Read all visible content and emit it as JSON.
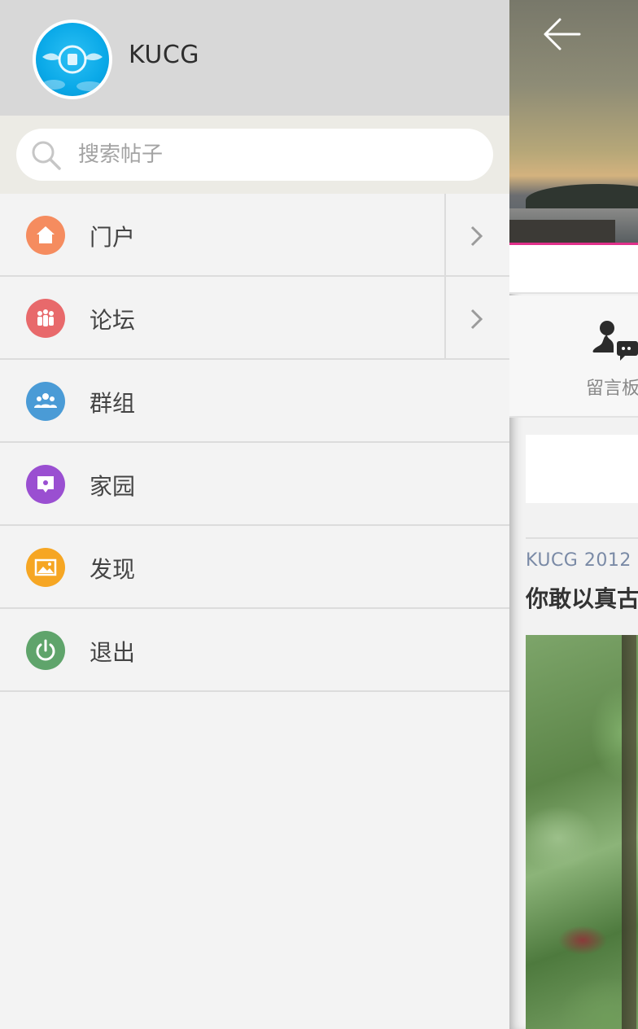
{
  "drawer": {
    "username": "KUCG",
    "search": {
      "placeholder": "搜索帖子",
      "value": ""
    },
    "menu": [
      {
        "label": "门户",
        "icon": "home-icon",
        "color": "#f58c5f",
        "has_arrow": true
      },
      {
        "label": "论坛",
        "icon": "people-icon",
        "color": "#e8696b",
        "has_arrow": true
      },
      {
        "label": "群组",
        "icon": "group-icon",
        "color": "#4a9bd6",
        "has_arrow": false
      },
      {
        "label": "家园",
        "icon": "home-card-icon",
        "color": "#9a4fd1",
        "has_arrow": false
      },
      {
        "label": "发现",
        "icon": "picture-icon",
        "color": "#f6a623",
        "has_arrow": false
      },
      {
        "label": "退出",
        "icon": "power-icon",
        "color": "#5fa46b",
        "has_arrow": false
      }
    ]
  },
  "page": {
    "message_board_label": "留言板",
    "post": {
      "meta": "KUCG 2012",
      "title": "你敢以真古"
    }
  },
  "colors": {
    "header_bg": "#d8d8d8",
    "drawer_bg": "#f3f3f3",
    "accent_underline": "#e0308a"
  }
}
